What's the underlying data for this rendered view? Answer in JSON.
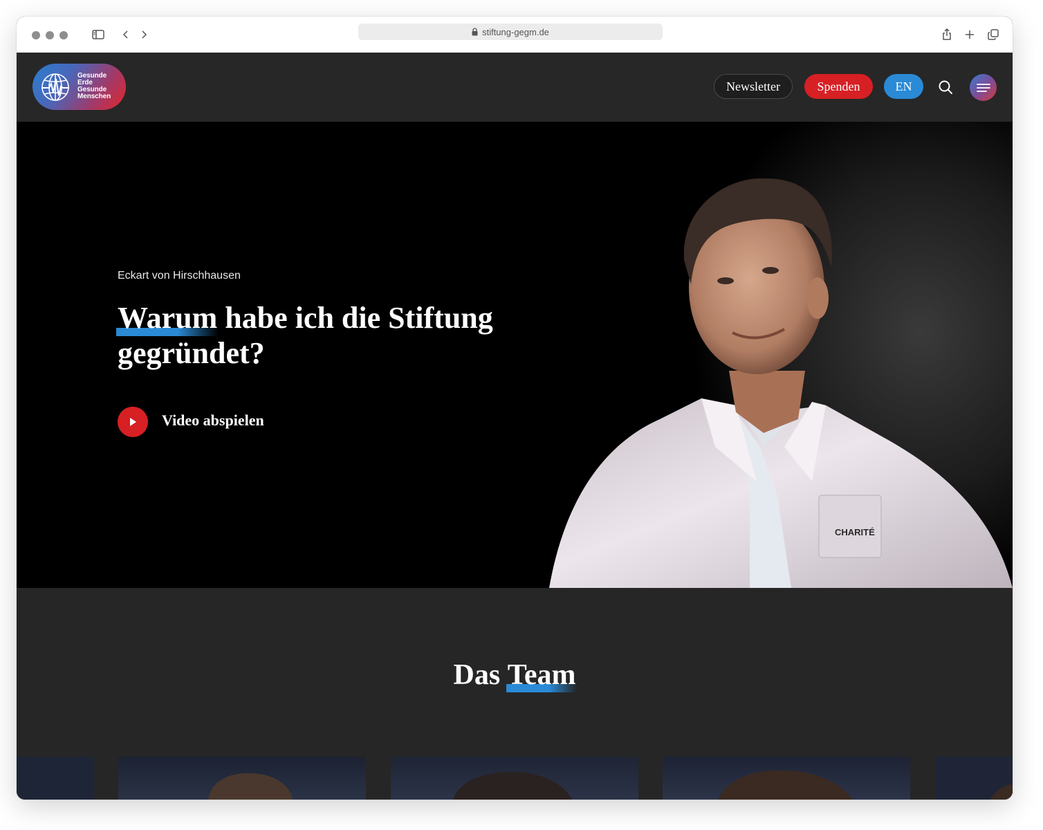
{
  "browser": {
    "url": "stiftung-gegm.de"
  },
  "header": {
    "logo_lines": [
      "Gesunde",
      "Erde",
      "Gesunde",
      "Menschen"
    ],
    "newsletter_label": "Newsletter",
    "donate_label": "Spenden",
    "language_label": "EN"
  },
  "hero": {
    "eyebrow": "Eckart von Hirschhausen",
    "title_highlight": "Warum",
    "title_rest": " habe ich die Stiftung gegründet?",
    "play_label": "Video abspielen",
    "badge_text": "CHARITÉ"
  },
  "team": {
    "title_plain": "Das ",
    "title_highlight": "Team"
  },
  "colors": {
    "accent_red": "#d62024",
    "accent_blue": "#2a8ad6",
    "header_bg": "#272727",
    "section_bg": "#262626"
  }
}
